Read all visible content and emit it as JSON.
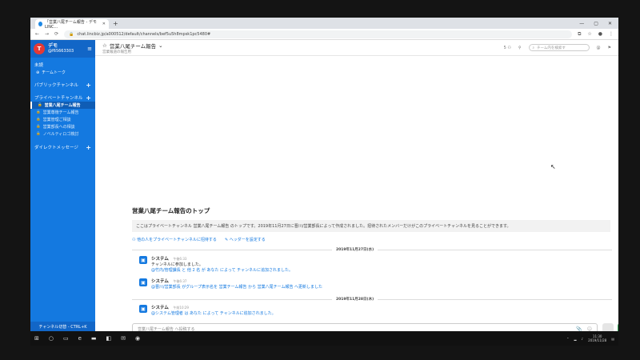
{
  "browser": {
    "tab_title": "「営業八尾チーム報告 - デモ LINC...",
    "url": "chat.lincbiz.jp/a000512/default/channels/bef5u5h8mpsk1pc5480#",
    "window_controls": [
      "—",
      "▢",
      "✕"
    ]
  },
  "sidebar": {
    "team_name": "デモ",
    "user_id": "@f65663303",
    "sections": {
      "unread": "未読",
      "team_talk": "チームトーク",
      "public": "パブリックチャンネル",
      "private": "プライベートチャンネル",
      "direct": "ダイレクトメッセージ"
    },
    "private_channels": [
      "営業八尾チーム報告",
      "営業尊徳チーム報告",
      "営業管理ご相談",
      "営業部長への相談",
      "ノベルティロゴ検討"
    ],
    "footer": "チャンネル切替 - CTRL+K"
  },
  "channel": {
    "title": "営業八尾チーム報告",
    "purpose": "営業報道の報告用",
    "member_count": "5",
    "search_placeholder": "チーム内を検索す"
  },
  "intro": {
    "heading": "営業八尾チーム報告のトップ",
    "description": "ここはプライベートチャンネル 営業八尾チーム報告 のトップです。2019年11月27日に晋川/営業部長によって作成されました。招待されたメンバーだけがこのプライベートチャンネルを見ることができます。",
    "invite": "他の人をプライベートチャンネルに招待する",
    "set_header": "ヘッダーを設定する"
  },
  "dates": [
    "2019年11月27日(水)",
    "2019年11月28日(木)"
  ],
  "posts": [
    {
      "name": "システム",
      "time": "午後6:33",
      "lines": [
        "チャンネルに参加しました。"
      ]
    },
    {
      "name": "",
      "time": "",
      "lines": [
        "@竹内/管理課長 と 他 2 名 が あなた によって チャンネルに追加されました。"
      ]
    },
    {
      "name": "システム",
      "time": "午後6:37",
      "lines": [
        "@晋川/営業部長 がグループ表示名を 営業チーム報告 から 営業八尾チーム報告 へ更新しました"
      ]
    },
    {
      "name": "システム",
      "time": "午前10:29",
      "lines": [
        "@システム管理者 は あなた によって チャンネルに追加されました。"
      ]
    }
  ],
  "composer": {
    "placeholder": "営業八尾チーム報告 へ投稿する",
    "help": "投稿のヘルプ"
  },
  "taskbar": {
    "time": "11:30",
    "date": "2019/11/28"
  },
  "colors": {
    "sidebar": "#1479e0",
    "accent": "#1479e0",
    "send_active": "#2e9e4f"
  }
}
